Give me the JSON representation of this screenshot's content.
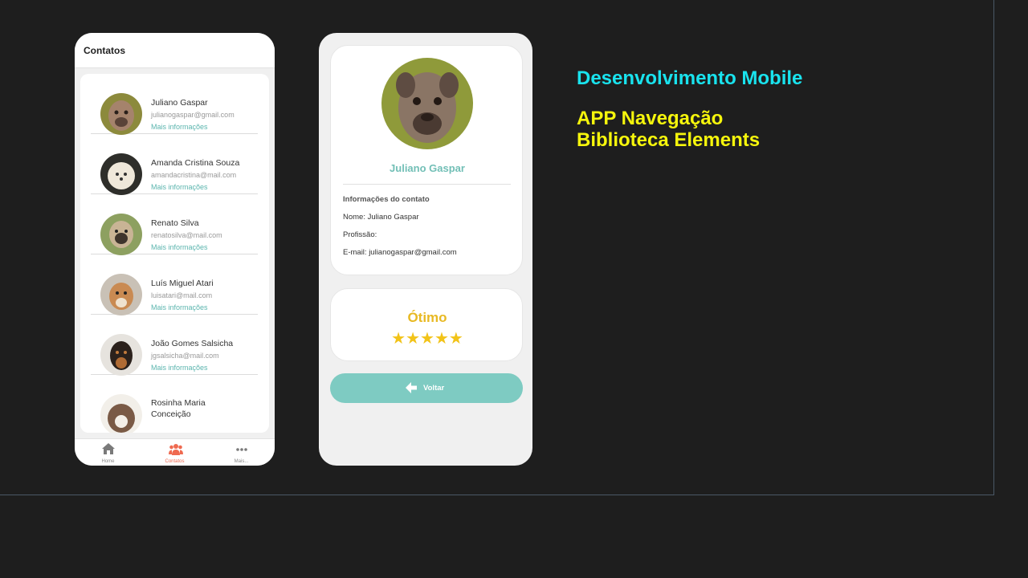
{
  "slide": {
    "heading": "Desenvolvimento Mobile",
    "subheading_line1": "APP Navegação",
    "subheading_line2": "Biblioteca Elements",
    "colors": {
      "heading": "#19e3ee",
      "subheading": "#f6f60c",
      "background": "#1e1e1e"
    }
  },
  "contacts_screen": {
    "title": "Contatos",
    "contacts": [
      {
        "name": "Juliano Gaspar",
        "email": "julianogaspar@gmail.com",
        "more": "Mais informações"
      },
      {
        "name": "Amanda Cristina Souza",
        "email": "amandacristina@mail.com",
        "more": "Mais informações"
      },
      {
        "name": "Renato Silva",
        "email": "renatosilva@mail.com",
        "more": "Mais informações"
      },
      {
        "name": "Luís Miguel Atari",
        "email": "luisatari@mail.com",
        "more": "Mais informações"
      },
      {
        "name": "João Gomes Salsicha",
        "email": "jgsalsicha@mail.com",
        "more": "Mais informações"
      },
      {
        "name": "Rosinha Maria Conceição",
        "email": "",
        "more": ""
      }
    ],
    "tabs": [
      {
        "label": "Home",
        "icon": "home-icon"
      },
      {
        "label": "Contatos",
        "icon": "users-icon",
        "active": true
      },
      {
        "label": "Mais...",
        "icon": "more-icon"
      }
    ]
  },
  "detail_screen": {
    "name": "Juliano Gaspar",
    "info_title": "Informações do contato",
    "name_line": "Nome: Juliano Gaspar",
    "profession_line": "Profissão:",
    "email_line": "E-mail: julianogaspar@gmail.com",
    "rating_label": "Ótimo",
    "rating_stars": 5,
    "stars_text": "★★★★★",
    "back_label": "Voltar"
  }
}
